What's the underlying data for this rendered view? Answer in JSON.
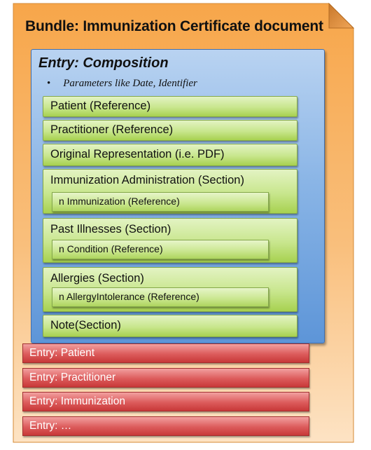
{
  "bundle": {
    "title": "Bundle: Immunization Certificate document",
    "color": "#f79a2e"
  },
  "composition": {
    "title": "Entry: Composition",
    "bullet": "Parameters like Date, Identifier",
    "color": "#8ab5e6",
    "items": [
      {
        "label": "Patient (Reference)"
      },
      {
        "label": "Practitioner (Reference)"
      },
      {
        "label": "Original Representation (i.e. PDF)"
      },
      {
        "label": "Immunization Administration (Section)",
        "sub": "n Immunization (Reference)"
      },
      {
        "label": "Past Illnesses (Section)",
        "sub": "n Condition (Reference)"
      },
      {
        "label": "Allergies (Section)",
        "sub": "n AllergyIntolerance (Reference)"
      },
      {
        "label": "Note(Section)"
      }
    ]
  },
  "entries": [
    {
      "label": "Entry: Patient"
    },
    {
      "label": "Entry: Practitioner"
    },
    {
      "label": "Entry: Immunization"
    },
    {
      "label": "Entry: …"
    }
  ],
  "colors": {
    "section_green": "#c8e68d",
    "entry_red": "#dc5b5b"
  }
}
